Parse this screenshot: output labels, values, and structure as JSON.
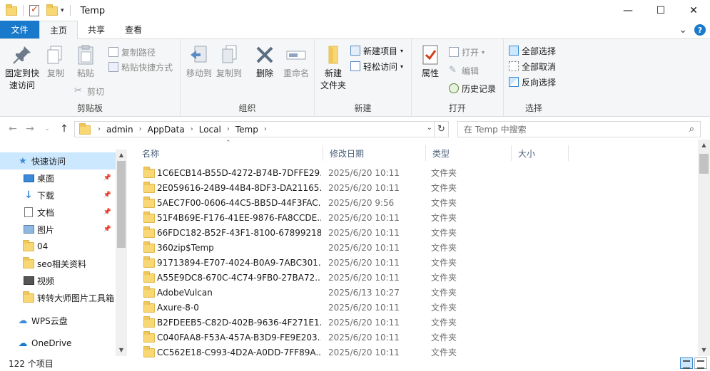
{
  "window": {
    "title": "Temp",
    "minimize_glyph": "—",
    "maximize_glyph": "☐",
    "close_glyph": "✕"
  },
  "tabs": {
    "file": "文件",
    "home": "主页",
    "share": "共享",
    "view": "查看",
    "expand_glyph": "⌄",
    "help_glyph": "?"
  },
  "ribbon": {
    "clipboard": {
      "label": "剪贴板",
      "pin_quick_access": "固定到快\n速访问",
      "copy": "复制",
      "paste": "粘贴",
      "copy_path": "复制路径",
      "paste_shortcut": "粘贴快捷方式",
      "cut": "剪切"
    },
    "organize": {
      "label": "组织",
      "move_to": "移动到",
      "copy_to": "复制到",
      "delete": "删除",
      "rename": "重命名"
    },
    "new": {
      "label": "新建",
      "new_folder": "新建\n文件夹",
      "new_item": "新建项目",
      "easy_access": "轻松访问"
    },
    "open": {
      "label": "打开",
      "properties": "属性",
      "open": "打开",
      "edit": "编辑",
      "history": "历史记录"
    },
    "select": {
      "label": "选择",
      "select_all": "全部选择",
      "select_none": "全部取消",
      "invert": "反向选择"
    }
  },
  "address": {
    "crumbs": [
      "admin",
      "AppData",
      "Local",
      "Temp"
    ],
    "search_placeholder": "在 Temp 中搜索"
  },
  "nav": {
    "items": [
      {
        "label": "快速访问",
        "icon": "star-icon",
        "pinned": false,
        "selected": true
      },
      {
        "label": "桌面",
        "icon": "desktop-icon",
        "pinned": true
      },
      {
        "label": "下载",
        "icon": "download-icon",
        "pinned": true
      },
      {
        "label": "文档",
        "icon": "document-icon",
        "pinned": true
      },
      {
        "label": "图片",
        "icon": "picture-icon",
        "pinned": true
      },
      {
        "label": "04",
        "icon": "folder-icon",
        "pinned": false
      },
      {
        "label": "seo相关资料",
        "icon": "folder-icon",
        "pinned": false
      },
      {
        "label": "视频",
        "icon": "video-icon",
        "pinned": false
      },
      {
        "label": "转转大师图片工具箱",
        "icon": "folder-icon",
        "pinned": false
      },
      {
        "label": "WPS云盘",
        "icon": "cloud-icon",
        "pinned": false
      },
      {
        "label": "OneDrive",
        "icon": "onedrive-icon",
        "pinned": false
      }
    ]
  },
  "columns": {
    "name": "名称",
    "date": "修改日期",
    "type": "类型",
    "size": "大小"
  },
  "files": [
    {
      "name": "1C6ECB14-B55D-4272-B74B-7DFFE29...",
      "date": "2025/6/20 10:11",
      "type": "文件夹"
    },
    {
      "name": "2E059616-24B9-44B4-8DF3-DA21165...",
      "date": "2025/6/20 10:11",
      "type": "文件夹"
    },
    {
      "name": "5AEC7F00-0606-44C5-BB5D-44F3FAC...",
      "date": "2025/6/20 9:56",
      "type": "文件夹"
    },
    {
      "name": "51F4B69E-F176-41EE-9876-FA8CCDE...",
      "date": "2025/6/20 10:11",
      "type": "文件夹"
    },
    {
      "name": "66FDC182-B52F-43F1-8100-67899218...",
      "date": "2025/6/20 10:11",
      "type": "文件夹"
    },
    {
      "name": "360zip$Temp",
      "date": "2025/6/20 10:11",
      "type": "文件夹"
    },
    {
      "name": "91713894-E707-4024-B0A9-7ABC301...",
      "date": "2025/6/20 10:11",
      "type": "文件夹"
    },
    {
      "name": "A55E9DC8-670C-4C74-9FB0-27BA72...",
      "date": "2025/6/20 10:11",
      "type": "文件夹"
    },
    {
      "name": "AdobeVulcan",
      "date": "2025/6/13 10:27",
      "type": "文件夹"
    },
    {
      "name": "Axure-8-0",
      "date": "2025/6/20 10:11",
      "type": "文件夹"
    },
    {
      "name": "B2FDEEB5-C82D-402B-9636-4F271E1...",
      "date": "2025/6/20 10:11",
      "type": "文件夹"
    },
    {
      "name": "C040FAA8-F53A-457A-B3D9-FE9E203...",
      "date": "2025/6/20 10:11",
      "type": "文件夹"
    },
    {
      "name": "CC562E18-C993-4D2A-A0DD-7FF89A...",
      "date": "2025/6/20 10:11",
      "type": "文件夹"
    }
  ],
  "status": {
    "count": "122 个项目"
  },
  "colors": {
    "accent": "#1979ca",
    "selection": "#cce8ff",
    "folder": "#f8d775"
  }
}
